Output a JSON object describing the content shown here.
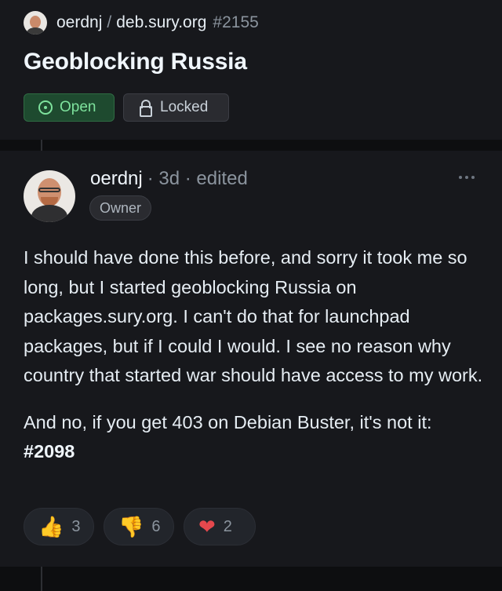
{
  "header": {
    "repo_owner": "oerdnj",
    "repo_separator": "/",
    "repo_name": "deb.sury.org",
    "issue_number": "#2155",
    "title": "Geoblocking Russia",
    "status_label": "Open",
    "lock_label": "Locked"
  },
  "comment": {
    "author": "oerdnj",
    "meta": "· 3d · edited",
    "role_badge": "Owner",
    "paragraph_1": "I should have done this before, and sorry it took me so long, but I started geoblocking Russia on packages.sury.org. I can't do that for launchpad packages, but if I could I would. I see no reason why country that started war should have access to my work.",
    "paragraph_2_text": "And no, if you get 403 on Debian Buster, it's not it:",
    "paragraph_2_link": "#2098",
    "reactions": [
      {
        "icon": "thumbs-up",
        "emoji": "👍",
        "count": "3"
      },
      {
        "icon": "thumbs-down",
        "emoji": "👎",
        "count": "6"
      },
      {
        "icon": "heart",
        "emoji": "❤",
        "count": "2"
      }
    ]
  },
  "colors": {
    "background": "#17181c",
    "open_green": "#7ee29d",
    "open_bg": "#1e4a2f",
    "heart_red": "#e5484d",
    "thumb_yellow": "#e3b341"
  }
}
